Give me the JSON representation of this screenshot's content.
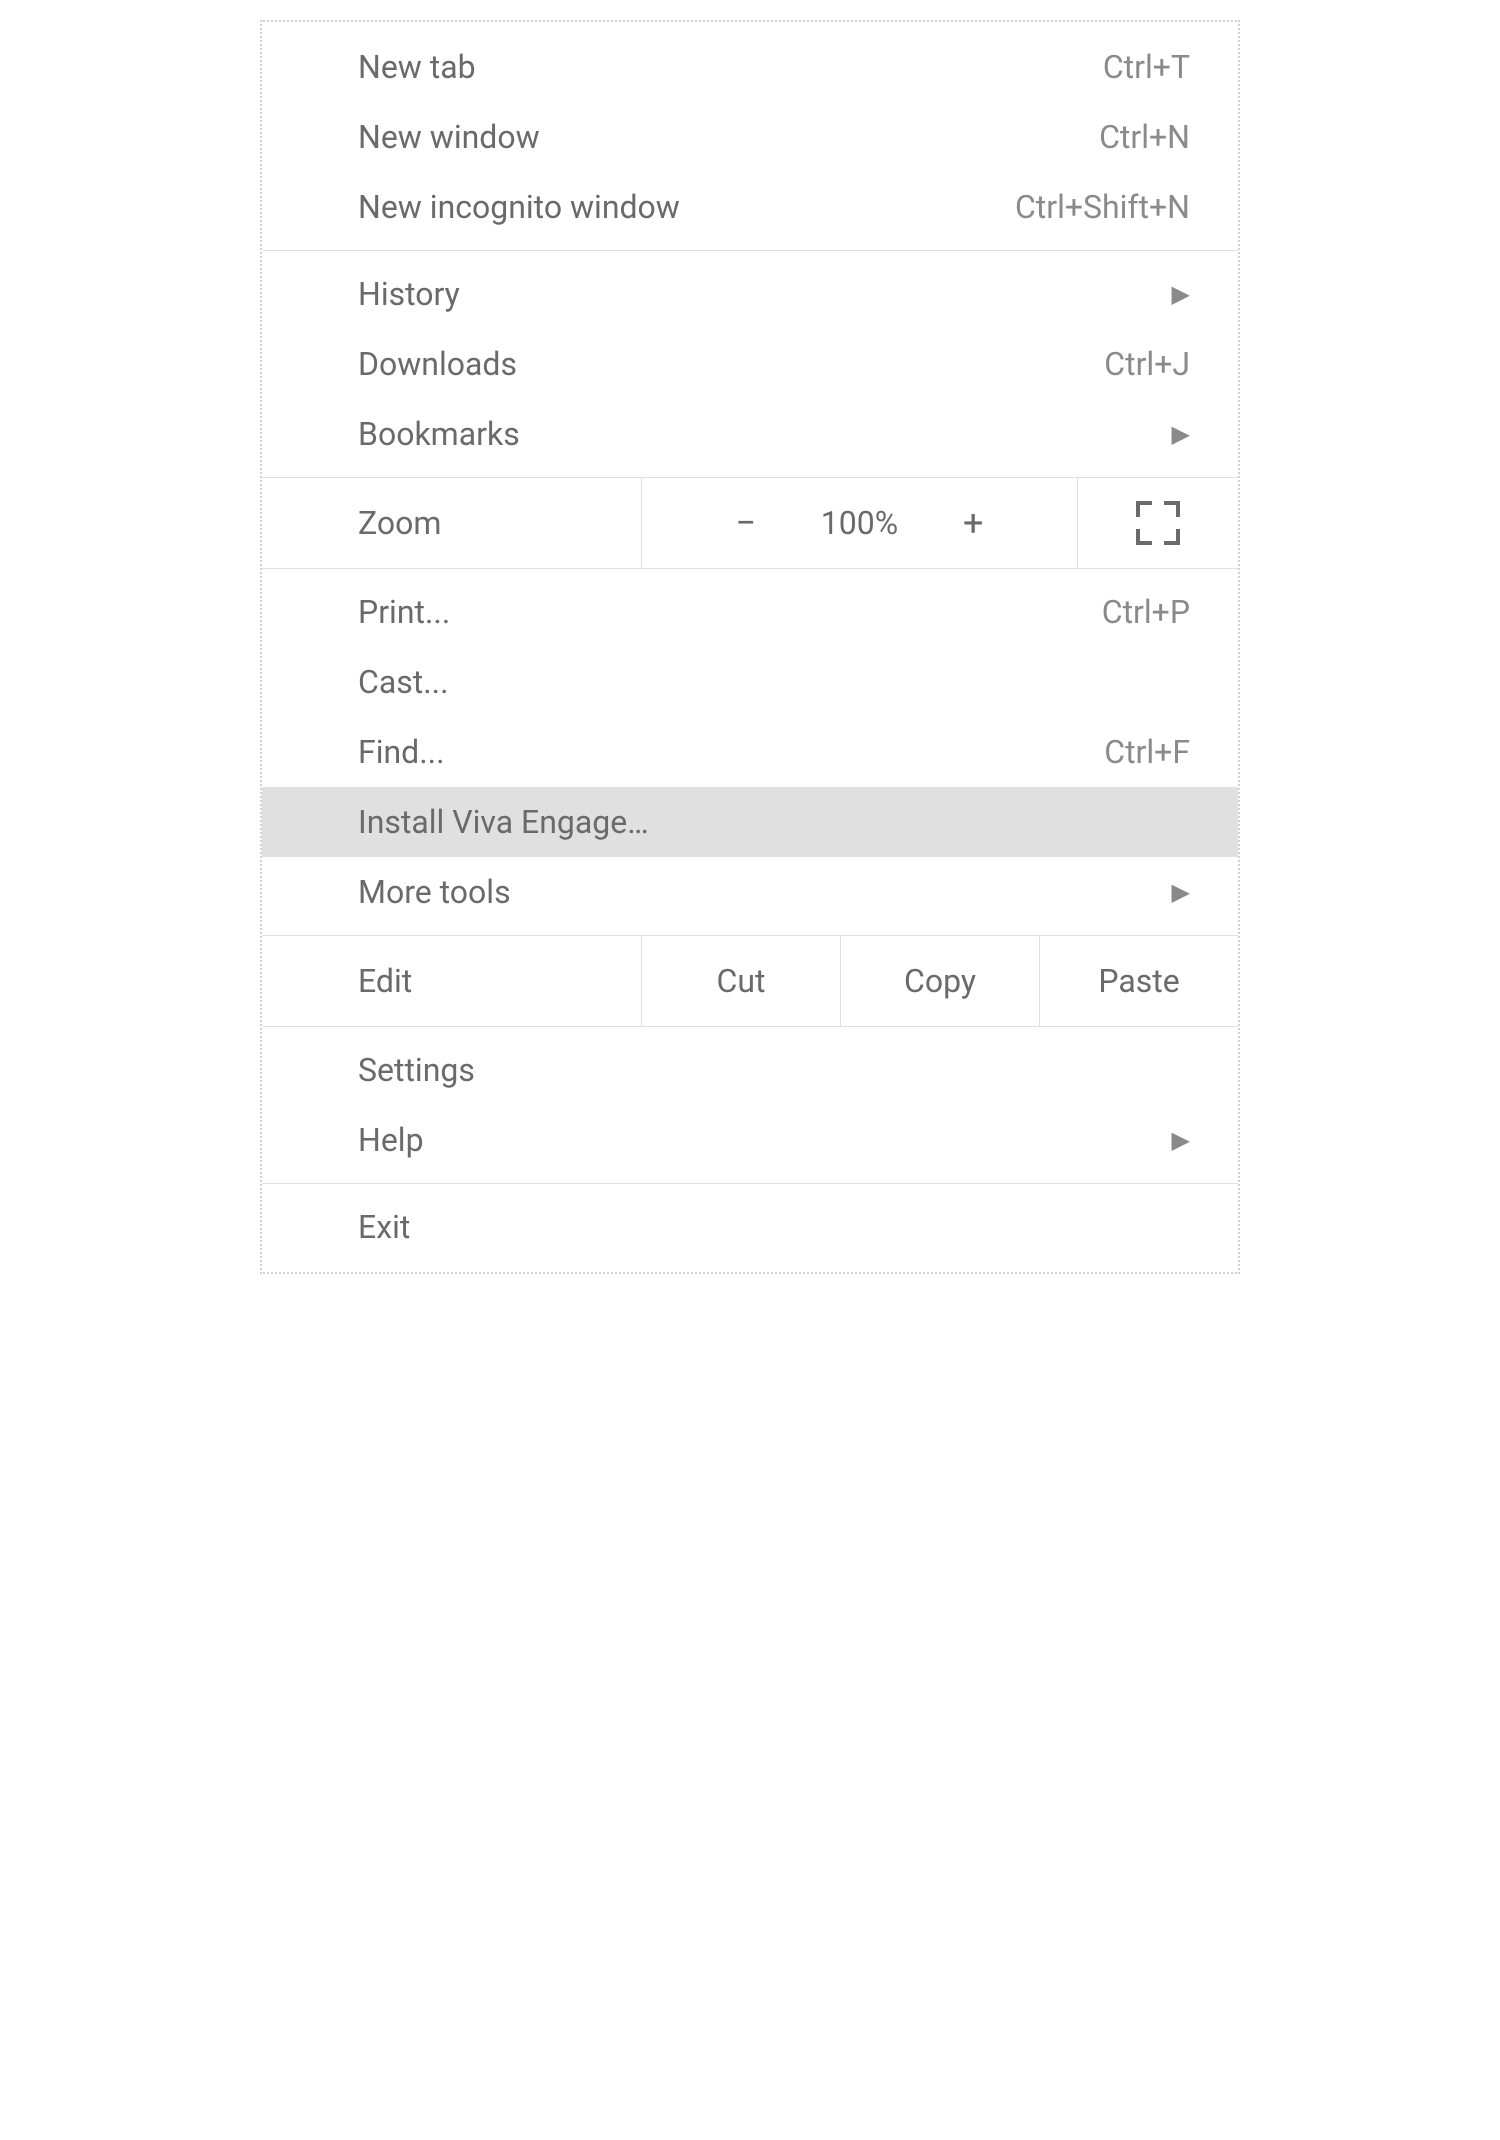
{
  "menu": {
    "new_tab": {
      "label": "New tab",
      "shortcut": "Ctrl+T"
    },
    "new_window": {
      "label": "New window",
      "shortcut": "Ctrl+N"
    },
    "new_incognito": {
      "label": "New incognito window",
      "shortcut": "Ctrl+Shift+N"
    },
    "history": {
      "label": "History"
    },
    "downloads": {
      "label": "Downloads",
      "shortcut": "Ctrl+J"
    },
    "bookmarks": {
      "label": "Bookmarks"
    },
    "zoom": {
      "label": "Zoom",
      "value": "100%",
      "minus": "−",
      "plus": "+"
    },
    "print": {
      "label": "Print...",
      "shortcut": "Ctrl+P"
    },
    "cast": {
      "label": "Cast..."
    },
    "find": {
      "label": "Find...",
      "shortcut": "Ctrl+F"
    },
    "install": {
      "label": "Install Viva Engage…"
    },
    "more_tools": {
      "label": "More tools"
    },
    "edit": {
      "label": "Edit",
      "cut": "Cut",
      "copy": "Copy",
      "paste": "Paste"
    },
    "settings": {
      "label": "Settings"
    },
    "help": {
      "label": "Help"
    },
    "exit": {
      "label": "Exit"
    }
  }
}
